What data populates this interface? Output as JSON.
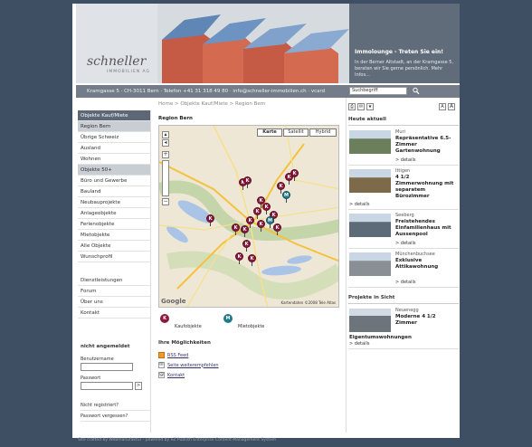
{
  "header": {
    "logo_text": "schneller",
    "logo_sub": "IMMOBILIEN AG",
    "promo_title": "Immolounge - Treten Sie ein!",
    "promo_text": "In der Berner Altstadt, an der Kramgasse 5, beraten wir Sie gerne persönlich. Mehr Infos...",
    "address_line": "Kramgasse 5 · CH-3011 Bern · Telefon +41 31 318 49 80 · info@schneller-immobilien.ch · vcard",
    "search_placeholder": "Suchbegriff",
    "search_icon": "search-icon"
  },
  "breadcrumb": "Home > Objekte Kauf/Miete > Region Bern",
  "sidebar": {
    "items": [
      {
        "label": "Objekte Kauf/Miete",
        "state": "head"
      },
      {
        "label": "Region Bern",
        "state": "selected"
      },
      {
        "label": "Übrige Schweiz",
        "state": ""
      },
      {
        "label": "Ausland",
        "state": ""
      },
      {
        "label": "Wohnen",
        "state": ""
      },
      {
        "label": "Objekte 50+",
        "state": "selected"
      },
      {
        "label": "Büro und Gewerbe",
        "state": ""
      },
      {
        "label": "Bauland",
        "state": ""
      },
      {
        "label": "Neubauprojekte",
        "state": ""
      },
      {
        "label": "Anlageobjekte",
        "state": ""
      },
      {
        "label": "Ferienobjekte",
        "state": ""
      },
      {
        "label": "Mietobjekte",
        "state": ""
      },
      {
        "label": "Alle Objekte",
        "state": ""
      },
      {
        "label": "Wunschprofil",
        "state": ""
      }
    ],
    "items2": [
      "Dienstleistungen",
      "Forum",
      "Über uns",
      "Kontakt"
    ]
  },
  "login": {
    "title": "nicht angemeldet",
    "user_label": "Benutzername",
    "pass_label": "Passwort",
    "submit": ">",
    "register": "Nicht registriert?",
    "forgot": "Passwort vergessen?"
  },
  "main": {
    "region_title": "Region Bern",
    "map_tabs": [
      "Karte",
      "Satellit",
      "Hybrid"
    ],
    "map_copyright": "Kartendaten ©2008 Tele Atlas",
    "map_logo": "Google",
    "legend": [
      {
        "letter": "K",
        "label": "Kaufobjekte",
        "color": "#8c1a3c"
      },
      {
        "letter": "M",
        "label": "Mietobjekte",
        "color": "#1e7b8c"
      }
    ],
    "options_title": "Ihre Möglichkeiten",
    "options": [
      {
        "icon": "rss-icon",
        "label": "RSS Feed"
      },
      {
        "icon": "mail-icon",
        "label": "Seite weiterempfehlen"
      },
      {
        "icon": "contact-icon",
        "label": "Kontakt"
      }
    ]
  },
  "right": {
    "font_small": "A",
    "font_large": "A",
    "heute_title": "Heute aktuell",
    "items": [
      {
        "city": "Muri",
        "title": "Repräsentative 6.5-Zimmer Gartenwohnung",
        "details": "> details",
        "thumb_color": "#6b7f5c"
      },
      {
        "city": "Ittigen",
        "title": "4 1/2 Zimmerwohnung mit separatem Bürozimmer",
        "details": "> details",
        "thumb_color": "#7d6a4a"
      },
      {
        "city": "Seeberg",
        "title": "Freistehendes Einfamilienhaus mit Aussenpool",
        "details": "> details",
        "thumb_color": "#5d6b78"
      },
      {
        "city": "Münchenbuchsee",
        "title": "Exklusive Attikawohnung",
        "details": "> details",
        "thumb_color": "#8a8f96"
      }
    ],
    "projekte_title": "Projekte in Sicht",
    "projekt": {
      "city": "Neuenegg",
      "title": "Moderne 4 1/2 Zimmer",
      "title2": "Eigentumswohnungen",
      "details": "> details",
      "thumb_color": "#6e747c"
    }
  },
  "footer": "Site crafted by Webmanufaktur · powered by eZ Publish Enterprise Content Management System"
}
